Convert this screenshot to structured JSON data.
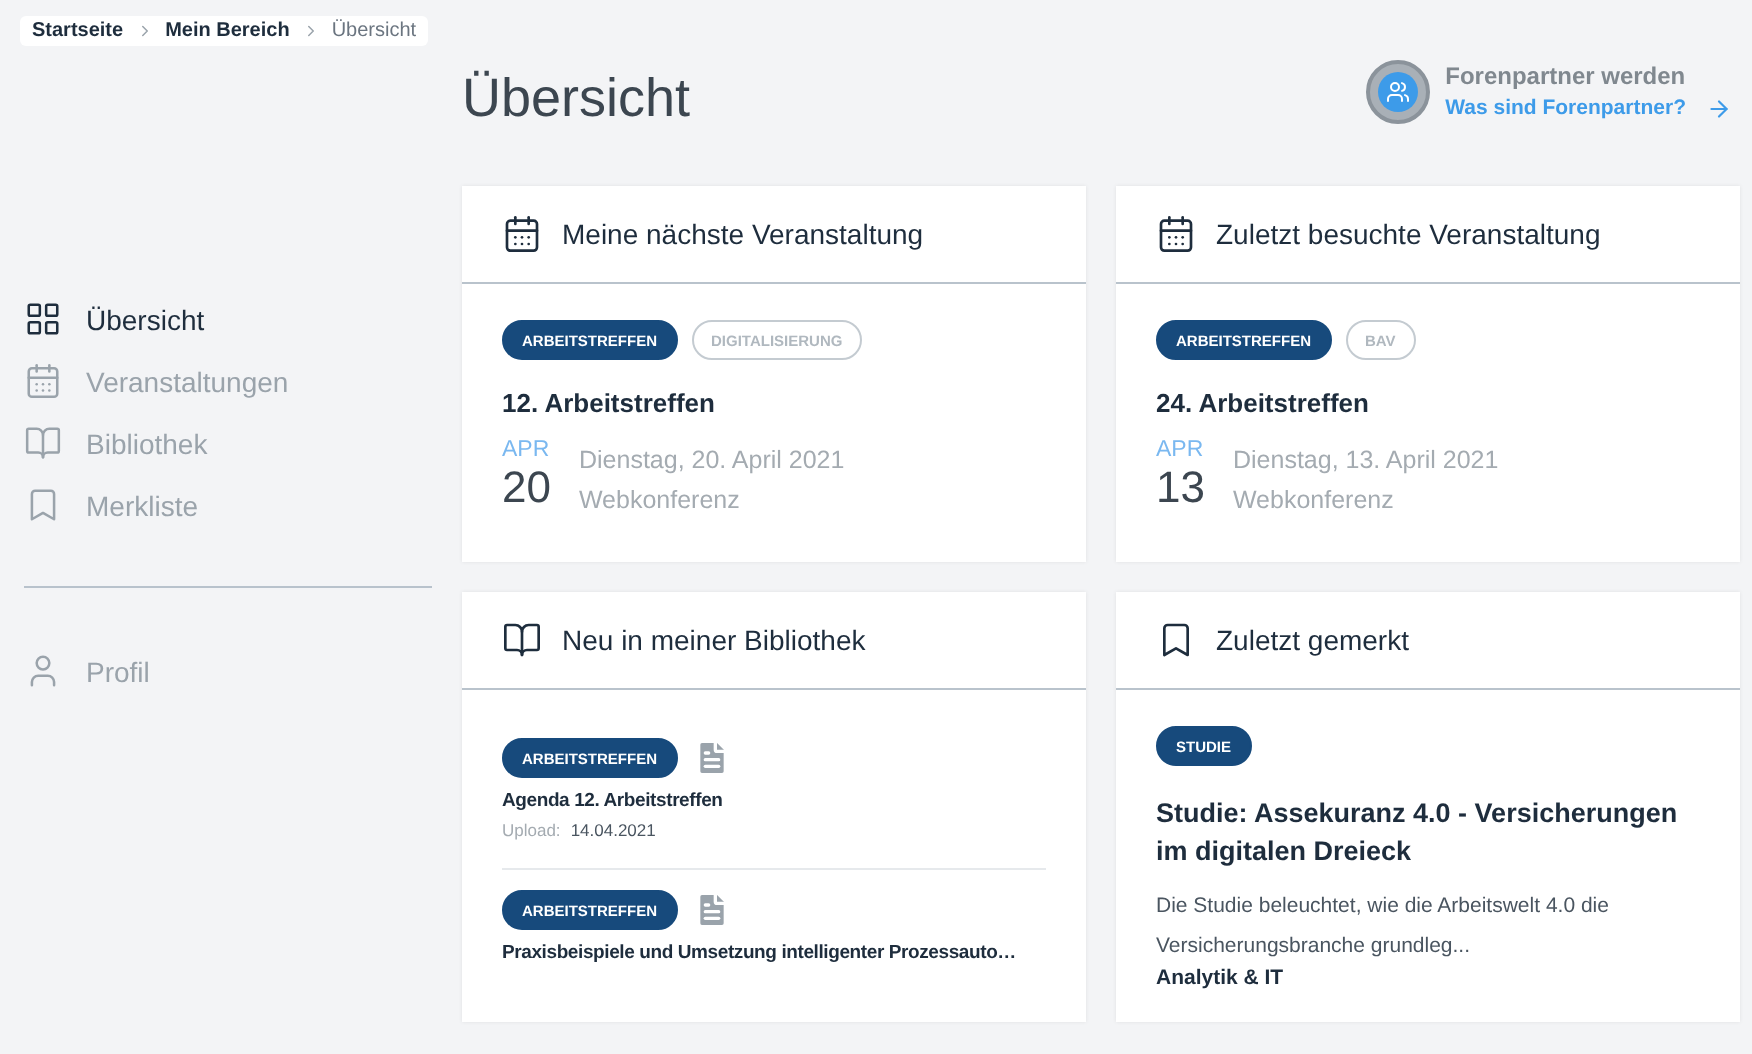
{
  "breadcrumb": [
    {
      "label": "Startseite",
      "current": false
    },
    {
      "label": "Mein Bereich",
      "current": false
    },
    {
      "label": "Übersicht",
      "current": true
    }
  ],
  "sidebar": {
    "items": [
      {
        "label": "Übersicht",
        "selected": true
      },
      {
        "label": "Veranstaltungen",
        "selected": false
      },
      {
        "label": "Bibliothek",
        "selected": false
      },
      {
        "label": "Merkliste",
        "selected": false
      }
    ],
    "profile": {
      "label": "Profil",
      "selected": false
    }
  },
  "page_title": "Übersicht",
  "partner": {
    "title": "Forenpartner werden",
    "link": "Was sind Forenpartner?"
  },
  "cards": [
    {
      "kind": "event",
      "title": "Meine nächste Veranstaltung",
      "tags": [
        {
          "label": "ARBEITSTREFFEN",
          "kind": "filled"
        },
        {
          "label": "DIGITALISIERUNG",
          "kind": "outline"
        }
      ],
      "event_title": "12. Arbeitstreffen",
      "month": "APR",
      "day": "20",
      "date": "Dienstag, 20. April 2021",
      "location": "Webkonferenz"
    },
    {
      "kind": "event",
      "title": "Zuletzt besuchte Veranstaltung",
      "tags": [
        {
          "label": "ARBEITSTREFFEN",
          "kind": "filled"
        },
        {
          "label": "BAV",
          "kind": "outline"
        }
      ],
      "event_title": "24. Arbeitstreffen",
      "month": "APR",
      "day": "13",
      "date": "Dienstag, 13. April 2021",
      "location": "Webkonferenz"
    },
    {
      "kind": "library",
      "title": "Neu in meiner Bibliothek",
      "items": [
        {
          "tag": "ARBEITSTREFFEN",
          "title": "Agenda 12. Arbeitstreffen",
          "upload_label": "Upload:",
          "upload_date": "14.04.2021"
        },
        {
          "tag": "ARBEITSTREFFEN",
          "title": "Praxisbeispiele und Umsetzung intelligenter Prozessauto…"
        }
      ]
    },
    {
      "kind": "bookmark",
      "title": "Zuletzt gemerkt",
      "tag": "STUDIE",
      "item_title": "Studie: Assekuranz 4.0 - Versicherungen im digitalen Dreieck",
      "description": "Die Studie beleuchtet, wie die Arbeitswelt 4.0 die Versicherungsbranche grundleg...",
      "category": "Analytik & IT"
    }
  ]
}
